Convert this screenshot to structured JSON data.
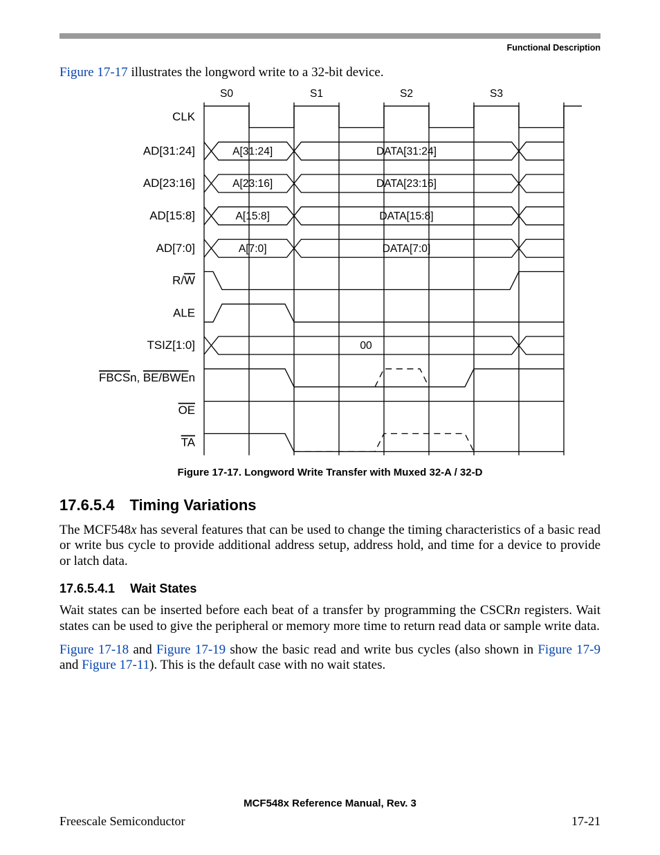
{
  "runningHead": "Functional Description",
  "intro": {
    "ref": "Figure 17-17",
    "rest": " illustrates the longword write to a 32-bit device."
  },
  "caption": "Figure 17-17. Longword Write Transfer with Muxed 32-A / 32-D",
  "h2": {
    "num": "17.6.5.4",
    "title": "Timing Variations"
  },
  "p1a": "The MCF548",
  "p1b": "x",
  "p1c": " has several features that can be used to change the timing characteristics of a basic read or write bus cycle to provide additional address setup, address hold, and time for a device to provide or latch data.",
  "h3": {
    "num": "17.6.5.4.1",
    "title": "Wait States"
  },
  "p2a": "Wait states can be inserted before each beat of a transfer by programming the CSCR",
  "p2b": "n",
  "p2c": " registers. Wait states can be used to give the peripheral or memory more time to return read data or sample write data.",
  "p3": {
    "ref1": "Figure 17-18",
    "t1": " and ",
    "ref2": "Figure 17-19",
    "t2": " show the basic read and write bus cycles (also shown in ",
    "ref3": "Figure 17-9",
    "t3": " and ",
    "ref4": "Figure 17-11",
    "t4": "). This is the default case with no wait states."
  },
  "footerCenter": "MCF548x Reference Manual, Rev. 3",
  "footerLeft": "Freescale Semiconductor",
  "footerRight": "17-21",
  "diagram": {
    "states": [
      "S0",
      "S1",
      "S2",
      "S3"
    ],
    "signals": [
      "CLK",
      "AD[31:24]",
      "AD[23:16]",
      "AD[15:8]",
      "AD[7:0]",
      "R/W̅",
      "ALE",
      "TSIZ[1:0]",
      "FBCSn, BE/BWEn",
      "O̅E̅",
      "T̅A̅"
    ],
    "rowA": [
      "A[31:24]",
      "A[23:16]",
      "A[15:8]",
      "A[7:0]"
    ],
    "rowD": [
      "DATA[31:24]",
      "DATA[23:16]",
      "DATA[15:8]",
      "DATA[7:0]"
    ],
    "tsizVal": "00"
  }
}
